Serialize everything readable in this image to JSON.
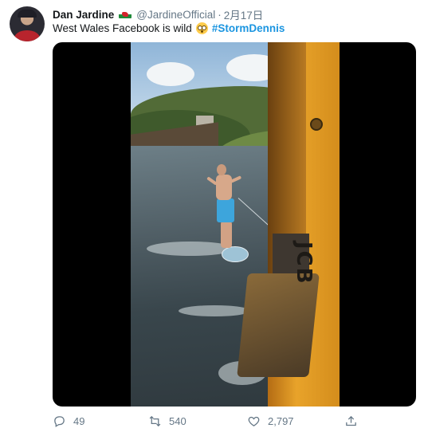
{
  "tweet": {
    "author_name": "Dan Jardine",
    "handle": "@JardineOfficial",
    "separator": "·",
    "date": "2月17日",
    "text": "West Wales Facebook is wild",
    "hashtag": "#StormDennis",
    "flag_icon": "wales-flag-icon",
    "emoji_icon": "flushed-face-emoji",
    "media": {
      "type": "video",
      "jcb_label": "JCB"
    }
  },
  "actions": {
    "reply_count": "49",
    "retweet_count": "540",
    "like_count": "2,797",
    "share_label": ""
  },
  "colors": {
    "accent": "#1b95e0",
    "secondary_text": "#657786",
    "primary_text": "#14171a"
  }
}
